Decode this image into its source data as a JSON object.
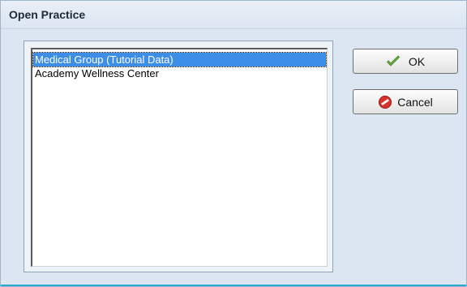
{
  "window": {
    "title": "Open Practice"
  },
  "practice_list": {
    "items": [
      {
        "label": "Medical Group (Tutorial Data)",
        "selected": true
      },
      {
        "label": "Academy Wellness Center",
        "selected": false
      }
    ]
  },
  "buttons": {
    "ok_label": "OK",
    "cancel_label": "Cancel"
  },
  "colors": {
    "selection": "#3d8ee6",
    "ok_icon": "#6cb33f",
    "cancel_icon": "#d9322c"
  },
  "icons": {
    "ok": "checkmark-icon",
    "cancel": "no-entry-icon"
  }
}
